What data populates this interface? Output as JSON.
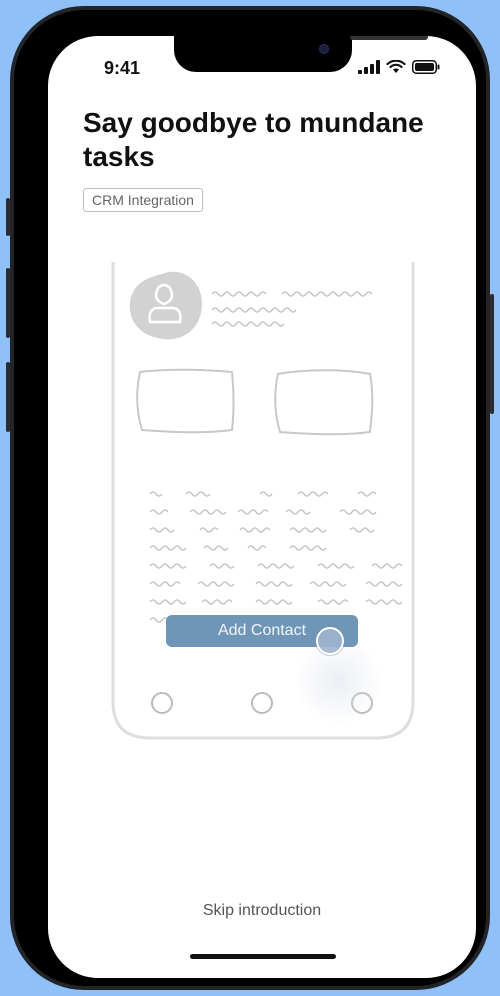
{
  "status_bar": {
    "time": "9:41",
    "icons": [
      "signal-icon",
      "wifi-icon",
      "battery-icon"
    ]
  },
  "onboarding": {
    "title": "Say goodbye to mundane tasks",
    "tag": "CRM Integration",
    "cta_label": "Add Contact",
    "skip_label": "Skip introduction"
  },
  "colors": {
    "background": "#8fc0f7",
    "cta": "#7096b7",
    "sketch": "#c8c8c8"
  }
}
